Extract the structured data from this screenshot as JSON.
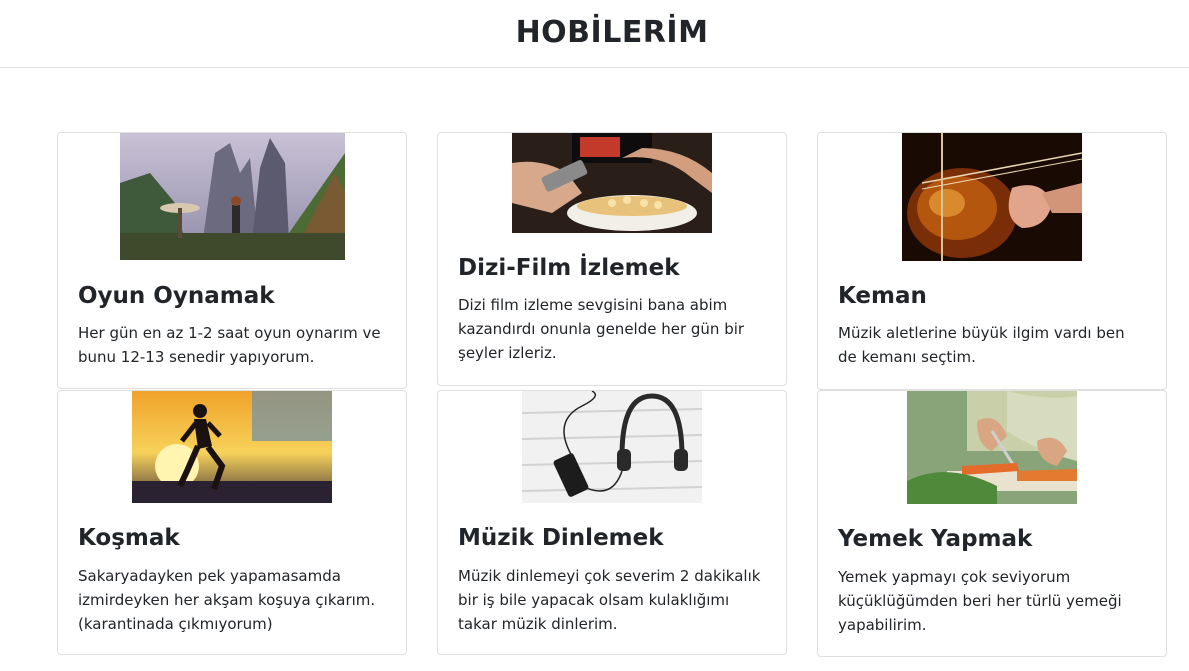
{
  "header": {
    "title": "HOBİLERİM"
  },
  "cards": [
    {
      "title": "Oyun Oynamak",
      "text": "Her gün en az 1-2 saat oyun oynarım ve bunu 12-13 senedir yapıyorum.",
      "image": "game-image"
    },
    {
      "title": "Dizi-Film İzlemek",
      "text": "Dizi film izleme sevgisini bana abim kazandırdı onunla genelde her gün bir şeyler izleriz.",
      "image": "tv-popcorn-image"
    },
    {
      "title": "Keman",
      "text": "Müzik aletlerine büyük ilgim vardı ben de kemanı seçtim.",
      "image": "violin-image"
    },
    {
      "title": "Koşmak",
      "text": "Sakaryadayken pek yapamasamda izmirdeyken her akşam koşuya çıkarım. (karantinada çıkmıyorum)",
      "image": "runner-image"
    },
    {
      "title": "Müzik Dinlemek",
      "text": "Müzik dinlemeyi çok severim 2 dakikalık bir iş bile yapacak olsam kulaklığımı takar müzik dinlerim.",
      "image": "headphones-image"
    },
    {
      "title": "Yemek Yapmak",
      "text": "Yemek yapmayı çok seviyorum küçüklüğümden beri her türlü yemeği yapabilirim.",
      "image": "cooking-image"
    }
  ]
}
